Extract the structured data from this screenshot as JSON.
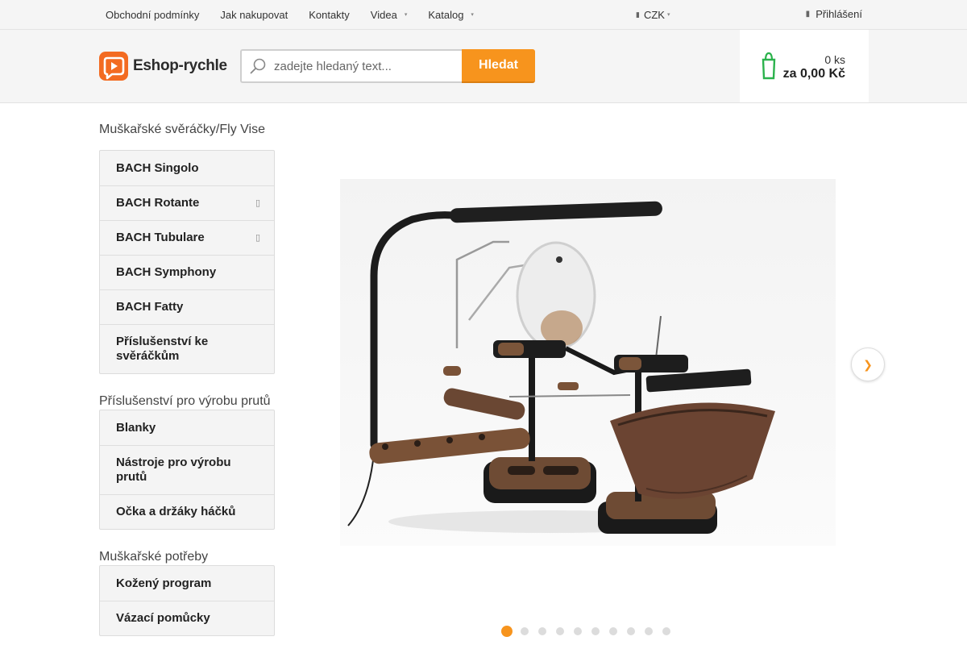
{
  "topbar": {
    "links": [
      {
        "label": "Obchodní podmínky",
        "has_caret": false
      },
      {
        "label": "Jak nakupovat",
        "has_caret": false
      },
      {
        "label": "Kontakty",
        "has_caret": false
      },
      {
        "label": "Videa",
        "has_caret": true
      },
      {
        "label": "Katalog",
        "has_caret": true
      }
    ],
    "currency": "CZK",
    "login": "Přihlášení"
  },
  "header": {
    "logo_text": "Eshop-rychle",
    "search_placeholder": "zadejte hledaný text...",
    "search_button": "Hledat",
    "cart_count": "0 ks",
    "cart_total": "za 0,00 Kč"
  },
  "sidebar": {
    "categories": [
      {
        "title": "Muškařské svěráčky/Fly Vise",
        "items": [
          {
            "label": "BACH Singolo",
            "has_submenu": false
          },
          {
            "label": "BACH Rotante",
            "has_submenu": true
          },
          {
            "label": "BACH Tubulare",
            "has_submenu": true
          },
          {
            "label": "BACH Symphony",
            "has_submenu": false
          },
          {
            "label": "BACH Fatty",
            "has_submenu": false
          },
          {
            "label": "Příslušenství ke svěráčkům",
            "has_submenu": false
          }
        ]
      },
      {
        "title": "Příslušenství pro výrobu prutů",
        "items": [
          {
            "label": "Blanky",
            "has_submenu": false
          },
          {
            "label": "Nástroje pro výrobu prutů",
            "has_submenu": false
          },
          {
            "label": "Očka a držáky háčků",
            "has_submenu": false
          }
        ]
      },
      {
        "title": "Muškařské potřeby",
        "items": [
          {
            "label": "Kožený program",
            "has_submenu": false
          },
          {
            "label": "Vázací pomůcky",
            "has_submenu": false
          }
        ]
      }
    ]
  },
  "slider": {
    "image": "fly-tying-vise-with-lamp-and-magnifier",
    "slide_count": 10,
    "active_slide": 1
  },
  "colors": {
    "accent": "#f7941d",
    "cart_icon": "#2bb24c",
    "logo": "#f36b21"
  }
}
